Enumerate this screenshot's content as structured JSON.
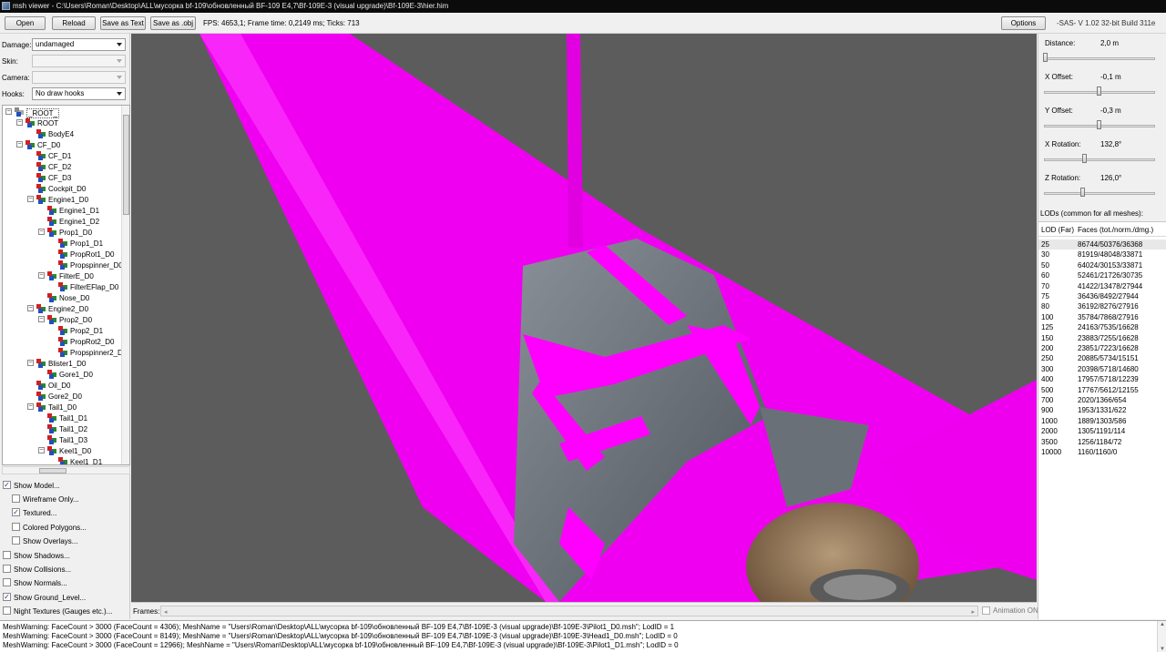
{
  "window": {
    "title": "msh viewer - C:\\Users\\Roman\\Desktop\\ALL\\мусорка bf-109\\обновленный BF-109 E4,7\\Bf-109E-3 (visual upgrade)\\Bf-109E-3\\hier.him"
  },
  "toolbar": {
    "open_label": "Open",
    "reload_label": "Reload",
    "save_text_label": "Save as Text",
    "save_obj_label": "Save as .obj",
    "stats": "FPS: 4653,1; Frame time: 0,2149 ms; Ticks: 713",
    "options_label": "Options",
    "version": "-SAS- V 1.02  32-bit  Build 311e"
  },
  "left": {
    "damage": {
      "label": "Damage:",
      "value": "undamaged"
    },
    "skin": {
      "label": "Skin:",
      "value": ""
    },
    "camera": {
      "label": "Camera:",
      "value": ""
    },
    "hooks": {
      "label": "Hooks:",
      "value": "No draw hooks"
    },
    "tree": [
      {
        "label": "_ROOT_",
        "depth": 0,
        "toggle": "−",
        "icon": "root"
      },
      {
        "label": "ROOT",
        "depth": 1,
        "toggle": "−",
        "icon": "mesh"
      },
      {
        "label": "BodyE4",
        "depth": 2,
        "toggle": "",
        "icon": "mesh"
      },
      {
        "label": "CF_D0",
        "depth": 1,
        "toggle": "−",
        "icon": "mesh"
      },
      {
        "label": "CF_D1",
        "depth": 2,
        "toggle": "",
        "icon": "mesh"
      },
      {
        "label": "CF_D2",
        "depth": 2,
        "toggle": "",
        "icon": "mesh"
      },
      {
        "label": "CF_D3",
        "depth": 2,
        "toggle": "",
        "icon": "mesh"
      },
      {
        "label": "Cockpit_D0",
        "depth": 2,
        "toggle": "",
        "icon": "mesh"
      },
      {
        "label": "Engine1_D0",
        "depth": 2,
        "toggle": "−",
        "icon": "mesh"
      },
      {
        "label": "Engine1_D1",
        "depth": 3,
        "toggle": "",
        "icon": "mesh"
      },
      {
        "label": "Engine1_D2",
        "depth": 3,
        "toggle": "",
        "icon": "mesh"
      },
      {
        "label": "Prop1_D0",
        "depth": 3,
        "toggle": "−",
        "icon": "mesh"
      },
      {
        "label": "Prop1_D1",
        "depth": 4,
        "toggle": "",
        "icon": "mesh"
      },
      {
        "label": "PropRot1_D0",
        "depth": 4,
        "toggle": "",
        "icon": "mesh"
      },
      {
        "label": "Propspinner_D0",
        "depth": 4,
        "toggle": "",
        "icon": "mesh"
      },
      {
        "label": "FilterE_D0",
        "depth": 3,
        "toggle": "−",
        "icon": "mesh"
      },
      {
        "label": "FilterEFlap_D0",
        "depth": 4,
        "toggle": "",
        "icon": "mesh"
      },
      {
        "label": "Nose_D0",
        "depth": 3,
        "toggle": "",
        "icon": "mesh"
      },
      {
        "label": "Engine2_D0",
        "depth": 2,
        "toggle": "−",
        "icon": "mesh"
      },
      {
        "label": "Prop2_D0",
        "depth": 3,
        "toggle": "−",
        "icon": "mesh"
      },
      {
        "label": "Prop2_D1",
        "depth": 4,
        "toggle": "",
        "icon": "mesh"
      },
      {
        "label": "PropRot2_D0",
        "depth": 4,
        "toggle": "",
        "icon": "mesh"
      },
      {
        "label": "Propspinner2_D0",
        "depth": 4,
        "toggle": "",
        "icon": "mesh"
      },
      {
        "label": "Blister1_D0",
        "depth": 2,
        "toggle": "−",
        "icon": "mesh"
      },
      {
        "label": "Gore1_D0",
        "depth": 3,
        "toggle": "",
        "icon": "mesh"
      },
      {
        "label": "Oil_D0",
        "depth": 2,
        "toggle": "",
        "icon": "mesh"
      },
      {
        "label": "Gore2_D0",
        "depth": 2,
        "toggle": "",
        "icon": "mesh"
      },
      {
        "label": "Tail1_D0",
        "depth": 2,
        "toggle": "−",
        "icon": "mesh"
      },
      {
        "label": "Tail1_D1",
        "depth": 3,
        "toggle": "",
        "icon": "mesh"
      },
      {
        "label": "Tail1_D2",
        "depth": 3,
        "toggle": "",
        "icon": "mesh"
      },
      {
        "label": "Tail1_D3",
        "depth": 3,
        "toggle": "",
        "icon": "mesh"
      },
      {
        "label": "Keel1_D0",
        "depth": 3,
        "toggle": "−",
        "icon": "mesh"
      },
      {
        "label": "Keel1_D1",
        "depth": 4,
        "toggle": "",
        "icon": "mesh"
      }
    ],
    "checks": [
      {
        "label": "Show Model...",
        "checked": true,
        "indent": 0
      },
      {
        "label": "Wireframe Only...",
        "checked": false,
        "indent": 1
      },
      {
        "label": "Textured...",
        "checked": true,
        "indent": 1
      },
      {
        "label": "Colored Polygons...",
        "checked": false,
        "indent": 1
      },
      {
        "label": "Show Overlays...",
        "checked": false,
        "indent": 1
      },
      {
        "label": "Show Shadows...",
        "checked": false,
        "indent": 0
      },
      {
        "label": "Show Collisions...",
        "checked": false,
        "indent": 0
      },
      {
        "label": "Show Normals...",
        "checked": false,
        "indent": 0
      },
      {
        "label": "Show Ground_Level...",
        "checked": true,
        "indent": 0
      },
      {
        "label": "Night Textures (Gauges etc.)...",
        "checked": false,
        "indent": 0
      }
    ]
  },
  "viewport": {
    "colors": {
      "background": "#5c5c5c",
      "magenta": "#ff00ff",
      "skin": "#6e747c"
    }
  },
  "frames": {
    "label": "Frames:",
    "animation_label": "Animation ON",
    "animation_on": false
  },
  "right": {
    "controls": [
      {
        "label": "Distance:",
        "value": "2,0 m",
        "fraction": 0.0
      },
      {
        "label": "X Offset:",
        "value": "-0,1 m",
        "fraction": 0.5
      },
      {
        "label": "Y Offset:",
        "value": "-0,3 m",
        "fraction": 0.5
      },
      {
        "label": "X Rotation:",
        "value": "132,8°",
        "fraction": 0.37
      },
      {
        "label": "Z Rotation:",
        "value": "126,0°",
        "fraction": 0.35
      }
    ],
    "lod_caption": "LODs (common for all meshes):",
    "lod_headers": [
      "LOD (Far)",
      "Faces (tot./norm./dmg.)"
    ],
    "lods": [
      [
        "25",
        "86744/50376/36368"
      ],
      [
        "30",
        "81919/48048/33871"
      ],
      [
        "50",
        "64024/30153/33871"
      ],
      [
        "60",
        "52461/21726/30735"
      ],
      [
        "70",
        "41422/13478/27944"
      ],
      [
        "75",
        "36436/8492/27944"
      ],
      [
        "80",
        "36192/8276/27916"
      ],
      [
        "100",
        "35784/7868/27916"
      ],
      [
        "125",
        "24163/7535/16628"
      ],
      [
        "150",
        "23883/7255/16628"
      ],
      [
        "200",
        "23851/7223/16628"
      ],
      [
        "250",
        "20885/5734/15151"
      ],
      [
        "300",
        "20398/5718/14680"
      ],
      [
        "400",
        "17957/5718/12239"
      ],
      [
        "500",
        "17767/5612/12155"
      ],
      [
        "700",
        "2020/1366/654"
      ],
      [
        "900",
        "1953/1331/622"
      ],
      [
        "1000",
        "1889/1303/586"
      ],
      [
        "2000",
        "1305/1191/114"
      ],
      [
        "3500",
        "1256/1184/72"
      ],
      [
        "10000",
        "1160/1160/0"
      ]
    ]
  },
  "log": [
    "MeshWarning: FaceCount > 3000 (FaceCount = 4306); MeshName = \"Users\\Roman\\Desktop\\ALL\\мусорка bf-109\\обновленный BF-109 E4,7\\Bf-109E-3 (visual upgrade)\\Bf-109E-3\\Pilot1_D0.msh\"; LodID = 1",
    "MeshWarning: FaceCount > 3000 (FaceCount = 8149); MeshName = \"Users\\Roman\\Desktop\\ALL\\мусорка bf-109\\обновленный BF-109 E4,7\\Bf-109E-3 (visual upgrade)\\Bf-109E-3\\Head1_D0.msh\"; LodID = 0",
    "MeshWarning: FaceCount > 3000 (FaceCount = 12966); MeshName = \"Users\\Roman\\Desktop\\ALL\\мусорка bf-109\\обновленный BF-109 E4,7\\Bf-109E-3 (visual upgrade)\\Bf-109E-3\\Pilot1_D1.msh\"; LodID = 0"
  ]
}
